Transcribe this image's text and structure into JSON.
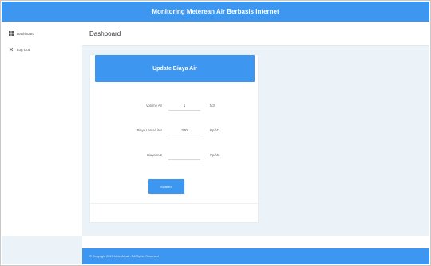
{
  "app": {
    "title": "Monitoring Meterean Air Berbasis Internet"
  },
  "sidebar": {
    "items": [
      {
        "label": "Dashboard",
        "icon": "dashboard-icon"
      },
      {
        "label": "Log Out",
        "icon": "logout-icon"
      }
    ]
  },
  "main": {
    "page_title": "Dashboard"
  },
  "form": {
    "title": "Update Biaya Air",
    "fields": [
      {
        "label": "Volume Air",
        "value": "1",
        "unit": "M3"
      },
      {
        "label": "Biaya Lama/Liter",
        "value": "300",
        "unit": "Rp/M3"
      },
      {
        "label": "Biayabru2",
        "value": "",
        "unit": "Rp/M3"
      }
    ],
    "submit_label": "SUBMIT"
  },
  "footer": {
    "text": "© Copyright 2017 MeterAiLab - All Rights Reserved"
  },
  "colors": {
    "accent": "#3d96ef",
    "background": "#ecf3f8"
  }
}
